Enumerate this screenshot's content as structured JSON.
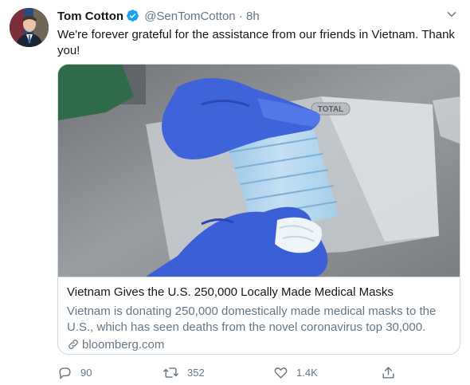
{
  "author": {
    "name": "Tom Cotton",
    "handle": "@SenTomCotton",
    "separator": "·",
    "time": "8h"
  },
  "tweet": {
    "text": "We're forever grateful for the assistance from our friends in Vietnam. Thank you!"
  },
  "card": {
    "title": "Vietnam Gives the U.S. 250,000 Locally Made Medical Masks",
    "description": "Vietnam is donating 250,000 domestically made medical masks to the U.S., which has seen deaths from the novel coronavirus top 30,000.",
    "domain": "bloomberg.com",
    "image_label": "TOTAL"
  },
  "actions": {
    "replies": "90",
    "retweets": "352",
    "likes": "1.4K"
  },
  "icons": {
    "verified": "verified-badge-icon",
    "caret": "chevron-down-icon",
    "link": "link-icon",
    "reply": "reply-icon",
    "retweet": "retweet-icon",
    "like": "heart-icon",
    "share": "share-icon"
  },
  "colors": {
    "verified": "#1da1f2",
    "secondary_text": "#657786",
    "border": "#cfd9de"
  }
}
